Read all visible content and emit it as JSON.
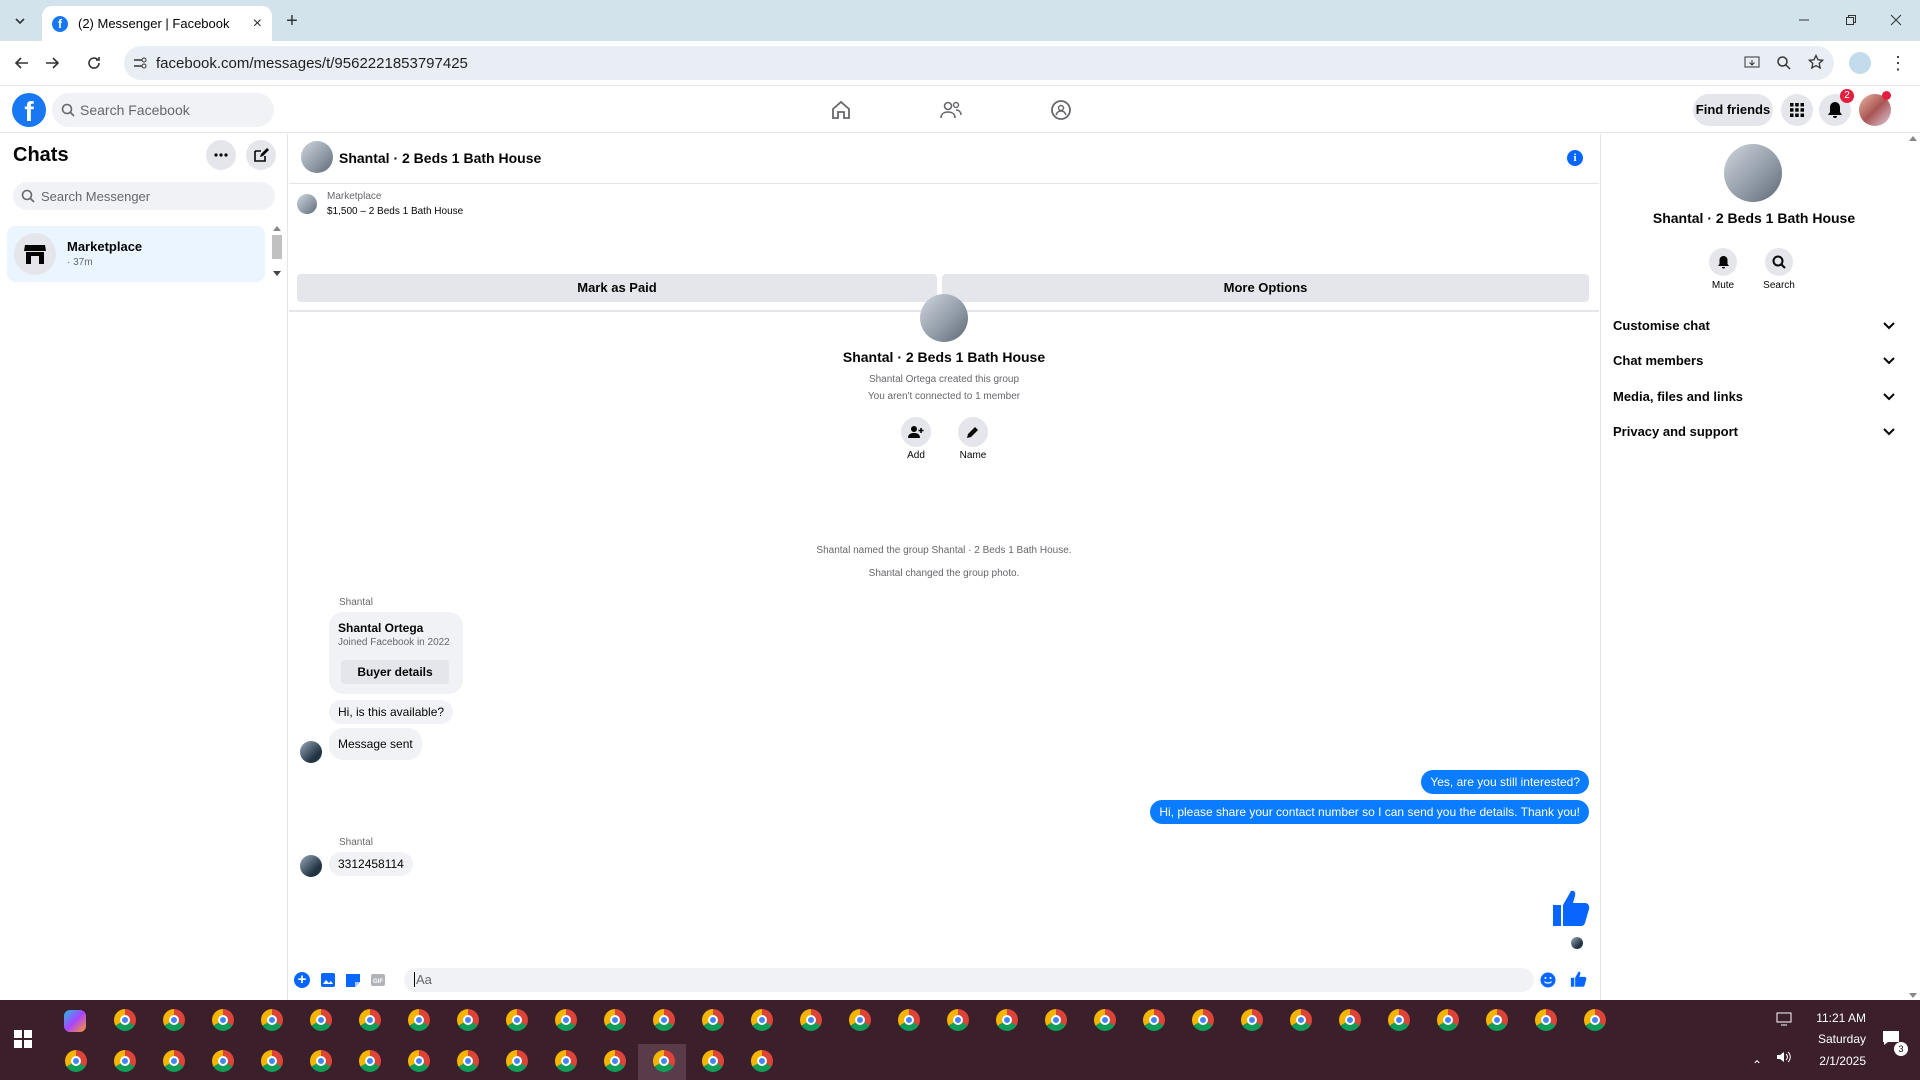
{
  "browser": {
    "tab_title": "(2) Messenger | Facebook",
    "url": "facebook.com/messages/t/9562221853797425"
  },
  "fb_header": {
    "search_placeholder": "Search Facebook",
    "find_friends": "Find friends",
    "notification_count": "2"
  },
  "sidebar": {
    "title": "Chats",
    "search_placeholder": "Search Messenger",
    "chats": [
      {
        "name": "Marketplace",
        "time": "· 37m"
      }
    ]
  },
  "conversation": {
    "title": "Shantal · 2 Beds 1 Bath House",
    "marketplace": {
      "label": "Marketplace",
      "listing": "$1,500 – 2 Beds 1 Bath House",
      "mark_paid": "Mark as Paid",
      "more_options": "More Options"
    },
    "intro": {
      "name": "Shantal · 2 Beds 1 Bath House",
      "created": "Shantal Ortega created this group",
      "connected": "You aren't connected to 1 member",
      "add": "Add",
      "name_label": "Name"
    },
    "system_msgs": [
      "Shantal named the group Shantal · 2 Beds 1 Bath House.",
      "Shantal changed the group photo."
    ],
    "buyer_card": {
      "sender": "Shantal",
      "name": "Shantal Ortega",
      "joined": "Joined Facebook in 2022",
      "button": "Buyer details"
    },
    "incoming1": [
      "Hi, is this available?",
      "Message sent"
    ],
    "outgoing": [
      "Yes, are you still interested?",
      "Hi, please share your contact number so I can send you the details. Thank you!"
    ],
    "incoming2": {
      "sender": "Shantal",
      "text": "3312458114"
    },
    "composer_placeholder": "Aa"
  },
  "details": {
    "title": "Shantal · 2 Beds 1 Bath House",
    "mute": "Mute",
    "search": "Search",
    "sections": [
      "Customise chat",
      "Chat members",
      "Media, files and links",
      "Privacy and support"
    ]
  },
  "taskbar": {
    "time": "11:21 AM",
    "day": "Saturday",
    "date": "2/1/2025",
    "notif_count": "3"
  }
}
